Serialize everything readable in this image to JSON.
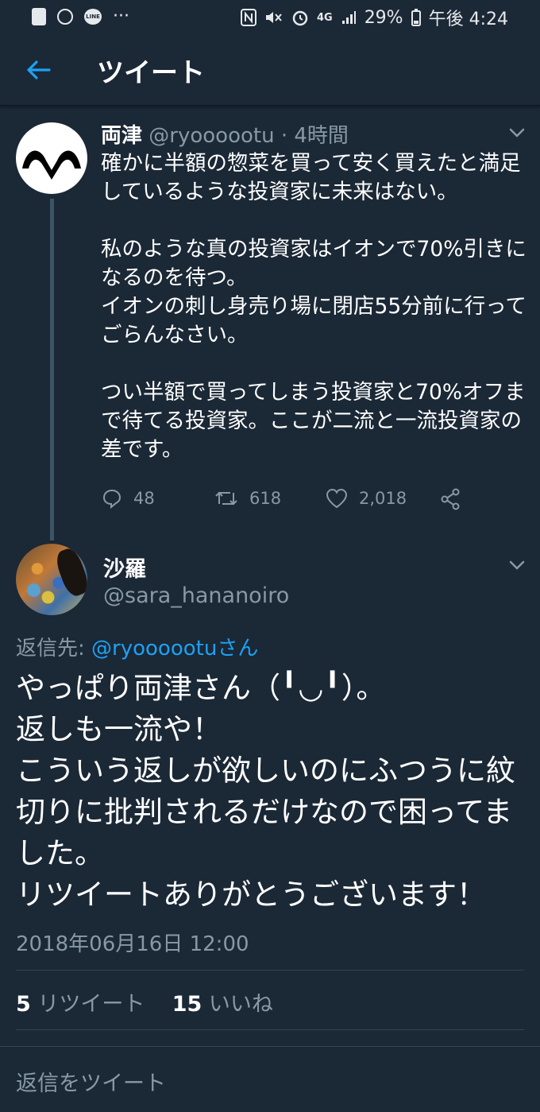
{
  "status_bar": {
    "line_icon": "LINE",
    "dots": "···",
    "network": "4G",
    "battery": "29%",
    "time": "午後 4:24"
  },
  "header": {
    "title": "ツイート",
    "back_icon": "arrow-left-icon"
  },
  "tweet1": {
    "name": "両津",
    "handle": "@ryoooootu",
    "separator": " · ",
    "time": "4時間",
    "text": "確かに半額の惣菜を買って安く買えたと満足しているような投資家に未来はない。\n\n私のような真の投資家はイオンで70%引きになるのを待つ。\nイオンの刺し身売り場に閉店55分前に行ってごらんなさい。\n\nつい半額で買ってしまう投資家と70%オフまで待てる投資家。ここが二流と一流投資家の差です。",
    "replies": "48",
    "retweets": "618",
    "likes": "2,018"
  },
  "tweet2": {
    "name": "沙羅",
    "handle": "@sara_hananoiro",
    "reply_to_label": "返信先: ",
    "reply_to_user": "@ryoooootuさん",
    "text": "やっぱり両津さん（╹◡╹）。\n返しも一流や！\nこういう返しが欲しいのにふつうに紋切りに批判されるだけなので困ってました。\nリツイートありがとうございます！",
    "timestamp": "2018年06月16日 12:00",
    "retweet_count": "5",
    "retweet_label": "リツイート",
    "like_count": "15",
    "like_label": "いいね"
  },
  "reply_bar": {
    "placeholder": "返信をツイート"
  },
  "colors": {
    "background": "#1b2836",
    "accent": "#1da1f2",
    "muted": "#8899a6",
    "divider": "#38444d"
  }
}
